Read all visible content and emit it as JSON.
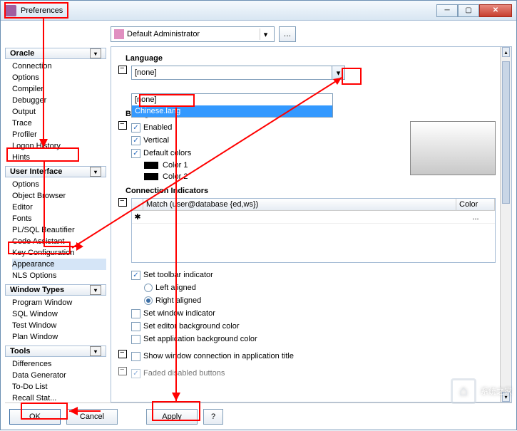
{
  "window": {
    "title": "Preferences"
  },
  "admin": {
    "label": "Default Administrator"
  },
  "sidebar": {
    "oracle": {
      "header": "Oracle",
      "items": [
        "Connection",
        "Options",
        "Compiler",
        "Debugger",
        "Output",
        "Trace",
        "Profiler",
        "Logon History",
        "Hints"
      ]
    },
    "ui": {
      "header": "User Interface",
      "items": [
        "Options",
        "Object Browser",
        "Editor",
        "Fonts",
        "PL/SQL Beautifier",
        "Code Assistant",
        "Key Configuration",
        "Appearance",
        "NLS Options"
      ]
    },
    "wt": {
      "header": "Window Types",
      "items": [
        "Program Window",
        "SQL Window",
        "Test Window",
        "Plan Window"
      ]
    },
    "tools": {
      "header": "Tools",
      "items": [
        "Differences",
        "Data Generator",
        "To-Do List",
        "Recall Stat..."
      ]
    }
  },
  "lang": {
    "header": "Language",
    "selected": "[none]",
    "options": [
      "[none]",
      "Chinese.lang"
    ]
  },
  "bggrad": {
    "header": "Background Gradient",
    "enabled": "Enabled",
    "vertical": "Vertical",
    "defcolors": "Default colors",
    "c1": "Color 1",
    "c2": "Color 2"
  },
  "conn": {
    "header": "Connection Indicators",
    "col_match": "Match (user@database {ed,ws})",
    "col_color": "Color",
    "ellipsis": "...",
    "toolbar_chk": "Set toolbar indicator",
    "left": "Left aligned",
    "right": "Right aligned",
    "winind": "Set window indicator",
    "editbg": "Set editor background color",
    "appbg": "Set application background color"
  },
  "misc": {
    "showconn": "Show window connection in application title",
    "faded": "Faded disabled buttons"
  },
  "buttons": {
    "ok": "OK",
    "cancel": "Cancel",
    "apply": "Apply"
  },
  "watermark": "系统之家"
}
